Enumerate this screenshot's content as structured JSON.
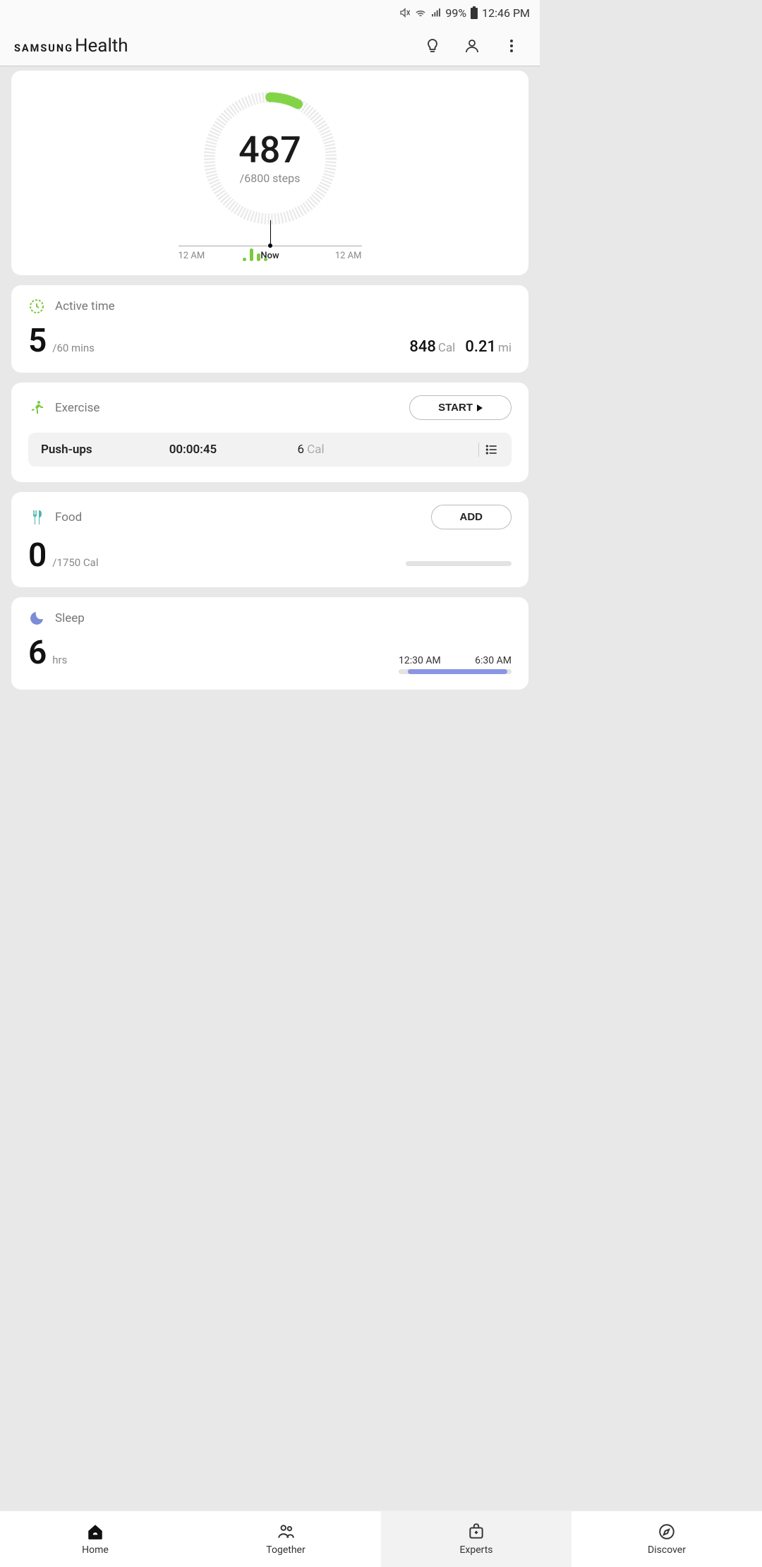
{
  "status": {
    "battery": "99%",
    "time": "12:46 PM"
  },
  "header": {
    "brand_small": "SAMSUNG",
    "brand_large": "Health"
  },
  "steps": {
    "value": "487",
    "goal_text": "/6800 steps",
    "timeline": {
      "left": "12 AM",
      "now": "Now",
      "right": "12 AM"
    }
  },
  "active": {
    "title": "Active time",
    "value": "5",
    "goal": "/60 mins",
    "cal_value": "848",
    "cal_unit": "Cal",
    "dist_value": "0.21",
    "dist_unit": "mi"
  },
  "exercise": {
    "title": "Exercise",
    "start": "START",
    "last": {
      "name": "Push-ups",
      "time": "00:00:45",
      "cal": "6",
      "cal_unit": "Cal"
    }
  },
  "food": {
    "title": "Food",
    "add": "ADD",
    "value": "0",
    "goal": "/1750 Cal"
  },
  "sleep": {
    "title": "Sleep",
    "value": "6",
    "unit": "hrs",
    "start": "12:30 AM",
    "end": "6:30 AM"
  },
  "nav": {
    "home": "Home",
    "together": "Together",
    "experts": "Experts",
    "discover": "Discover"
  }
}
